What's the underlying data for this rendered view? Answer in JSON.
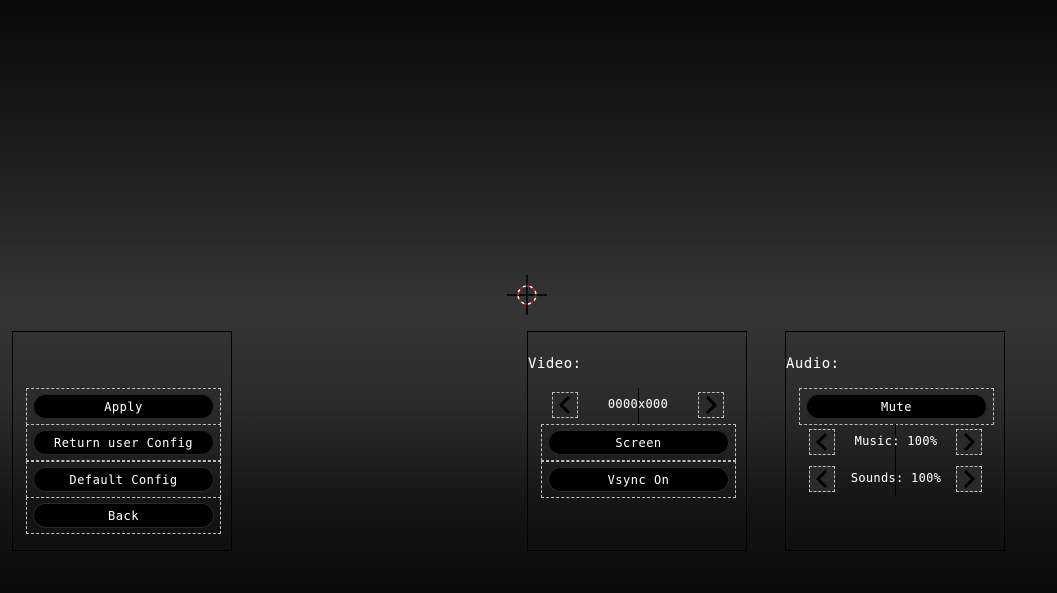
{
  "colors": {
    "background_top": "#090909",
    "background_mid": "#353535",
    "button_fill": "#000000",
    "text": "#ffffff",
    "dashed_border": "#bdbdbd",
    "crosshair_accent": "#d11b1b"
  },
  "crosshair": {
    "icon": "crosshair-icon"
  },
  "menu": {
    "apply_label": "Apply",
    "return_label": "Return user Config",
    "default_label": "Default Config",
    "back_label": "Back"
  },
  "video": {
    "title": "Video:",
    "resolution": "0000x000",
    "screen_label": "Screen",
    "vsync_label": "Vsync On",
    "prev_icon": "chevron-left-icon",
    "next_icon": "chevron-right-icon"
  },
  "audio": {
    "title": "Audio:",
    "mute_label": "Mute",
    "music_label": "Music: 100%",
    "sounds_label": "Sounds: 100%",
    "music_level": 1.0,
    "sounds_level": 1.0
  }
}
